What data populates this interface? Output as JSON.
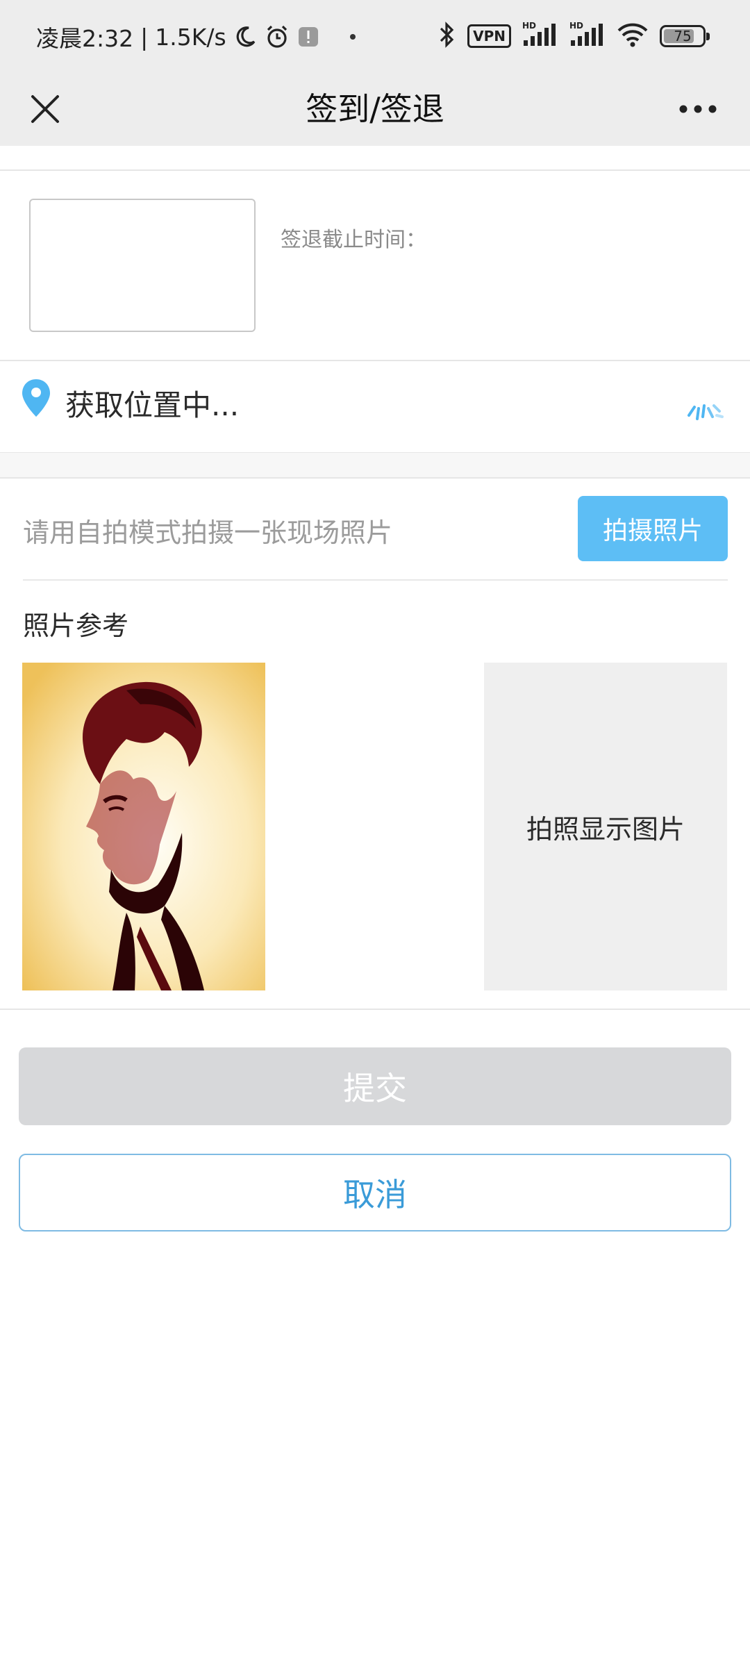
{
  "status_bar": {
    "time": "凌晨2:32",
    "separator": "|",
    "net_speed": "1.5K/s",
    "vpn_label": "VPN",
    "battery_level": "75",
    "icons": [
      "moon-icon",
      "alarm-icon",
      "notification-icon",
      "bluetooth-icon",
      "signal-icon",
      "wifi-icon",
      "battery-icon"
    ]
  },
  "nav": {
    "title": "签到/签退"
  },
  "checkout": {
    "deadline_label": "签退截止时间："
  },
  "location": {
    "status": "获取位置中..."
  },
  "photo": {
    "prompt": "请用自拍模式拍摄一张现场照片",
    "take_photo_label": "拍摄照片",
    "reference_title": "照片参考",
    "placeholder_text": "拍照显示图片"
  },
  "actions": {
    "submit_label": "提交",
    "cancel_label": "取消"
  },
  "colors": {
    "accent": "#5dbef5",
    "cancel_text": "#3a9bd8",
    "submit_disabled": "#d7d8da",
    "header_bg": "#ededed"
  }
}
